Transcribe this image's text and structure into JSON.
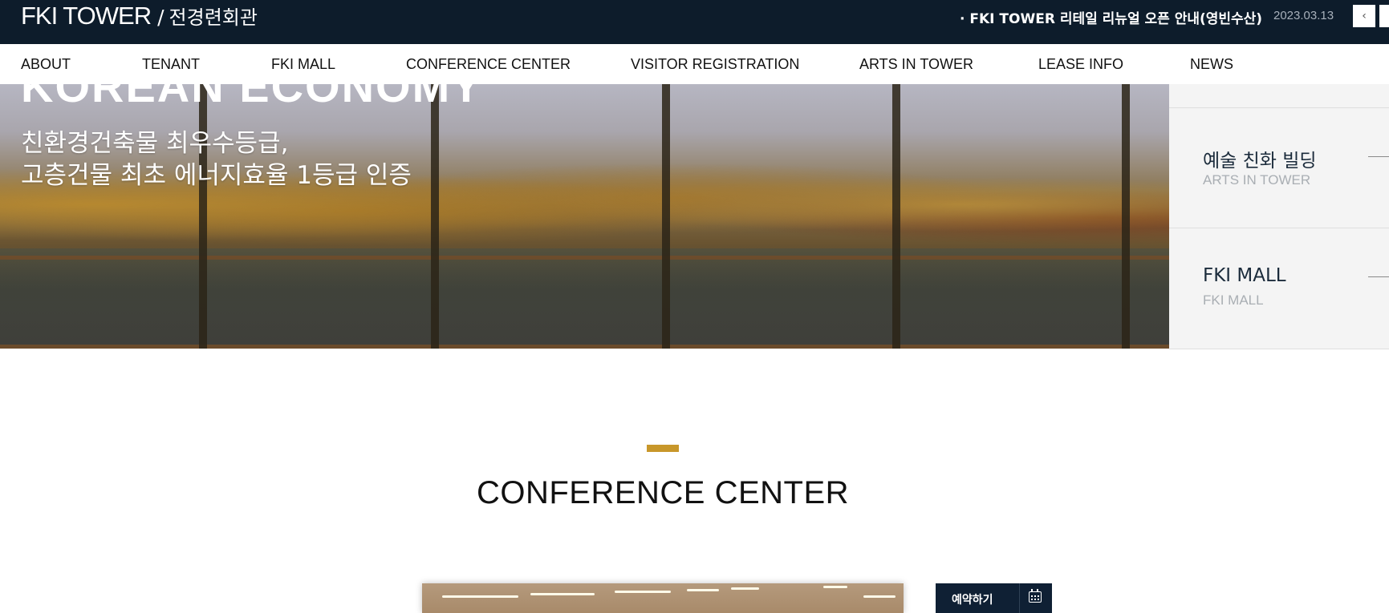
{
  "header": {
    "logo_en": "FKI TOWER",
    "logo_sep": "/",
    "logo_ko": "전경련회관",
    "notice": {
      "text": "· FKI TOWER 리테일 리뉴얼 오픈 안내(영빈수산)",
      "date": "2023.03.13",
      "prev_glyph": "‹",
      "prev_icon": "chevron-left-icon",
      "next_icon": "chevron-right-icon"
    }
  },
  "nav": {
    "items": [
      "ABOUT",
      "TENANT",
      "FKI MALL",
      "CONFERENCE CENTER",
      "VISITOR REGISTRATION",
      "ARTS IN TOWER",
      "LEASE INFO",
      "NEWS"
    ]
  },
  "hero": {
    "heading": "KOREAN ECONOMY",
    "line1": "친환경건축물 최우수등급,",
    "line2": "고층건물 최초 에너지효율 1등급 인증"
  },
  "side_panel": {
    "items": [
      {
        "title_ko": "예술 친화 빌딩",
        "title_en": "ARTS IN TOWER"
      },
      {
        "title_ko": "FKI MALL",
        "title_en": "FKI MALL"
      }
    ]
  },
  "section": {
    "title": "CONFERENCE CENTER",
    "reserve_label": "예약하기",
    "reserve_icon": "calendar-icon"
  },
  "colors": {
    "header_bg": "#0d1c2b",
    "accent": "#c8972a",
    "reserve_bg": "#0f2034",
    "side_panel_bg": "#f4f4f4"
  }
}
